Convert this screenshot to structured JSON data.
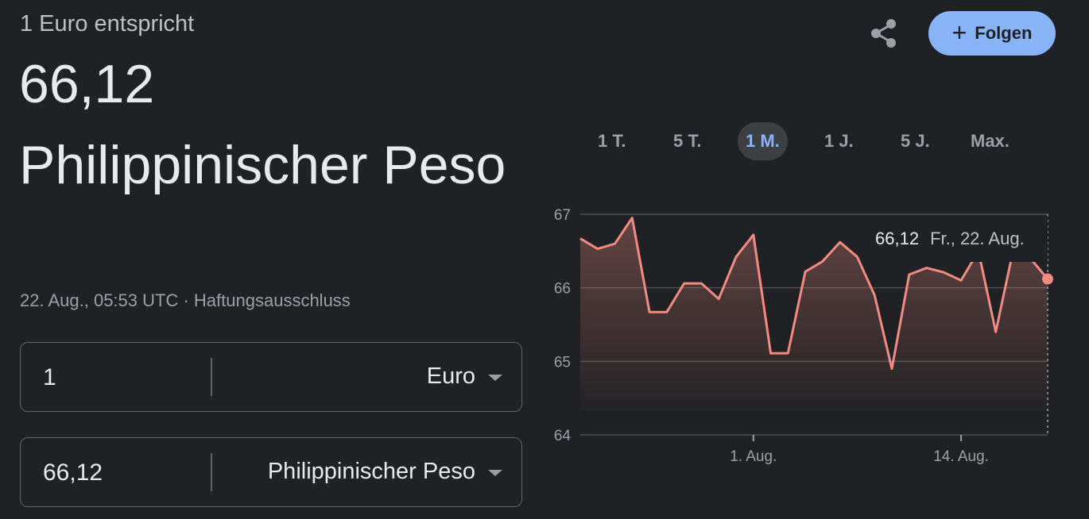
{
  "header": {
    "subtitle": "1 Euro entspricht",
    "rate_value": "66,12",
    "rate_currency": "Philippinischer Peso",
    "timestamp": "22. Aug., 05:53 UTC",
    "separator": "·",
    "disclaimer": "Haftungsausschluss"
  },
  "actions": {
    "share_icon": "share-icon",
    "follow_label": "Folgen"
  },
  "converter": {
    "from": {
      "amount": "1",
      "currency": "Euro"
    },
    "to": {
      "amount": "66,12",
      "currency": "Philippinischer Peso"
    }
  },
  "ranges": {
    "tabs": [
      "1 T.",
      "5 T.",
      "1 M.",
      "1 J.",
      "5 J.",
      "Max."
    ],
    "active": "1 M."
  },
  "tooltip": {
    "value": "66,12",
    "date": "Fr., 22. Aug."
  },
  "colors": {
    "line": "#f28b82",
    "accent": "#8ab4f8",
    "background": "#202124"
  },
  "chart_data": {
    "type": "area",
    "title": "",
    "xlabel": "",
    "ylabel": "",
    "ylim": [
      64,
      67
    ],
    "yticks": [
      64,
      65,
      66,
      67
    ],
    "xtick_labels": [
      "1. Aug.",
      "14. Aug."
    ],
    "grid": true,
    "series": [
      {
        "values": [
          66.67,
          66.53,
          66.6,
          66.95,
          65.67,
          65.67,
          66.06,
          66.06,
          65.85,
          66.42,
          66.72,
          65.11,
          65.11,
          66.22,
          66.36,
          66.62,
          66.42,
          65.9,
          64.9,
          66.18,
          66.27,
          66.21,
          66.1,
          66.5,
          65.4,
          66.5,
          66.4,
          66.12
        ]
      }
    ]
  }
}
